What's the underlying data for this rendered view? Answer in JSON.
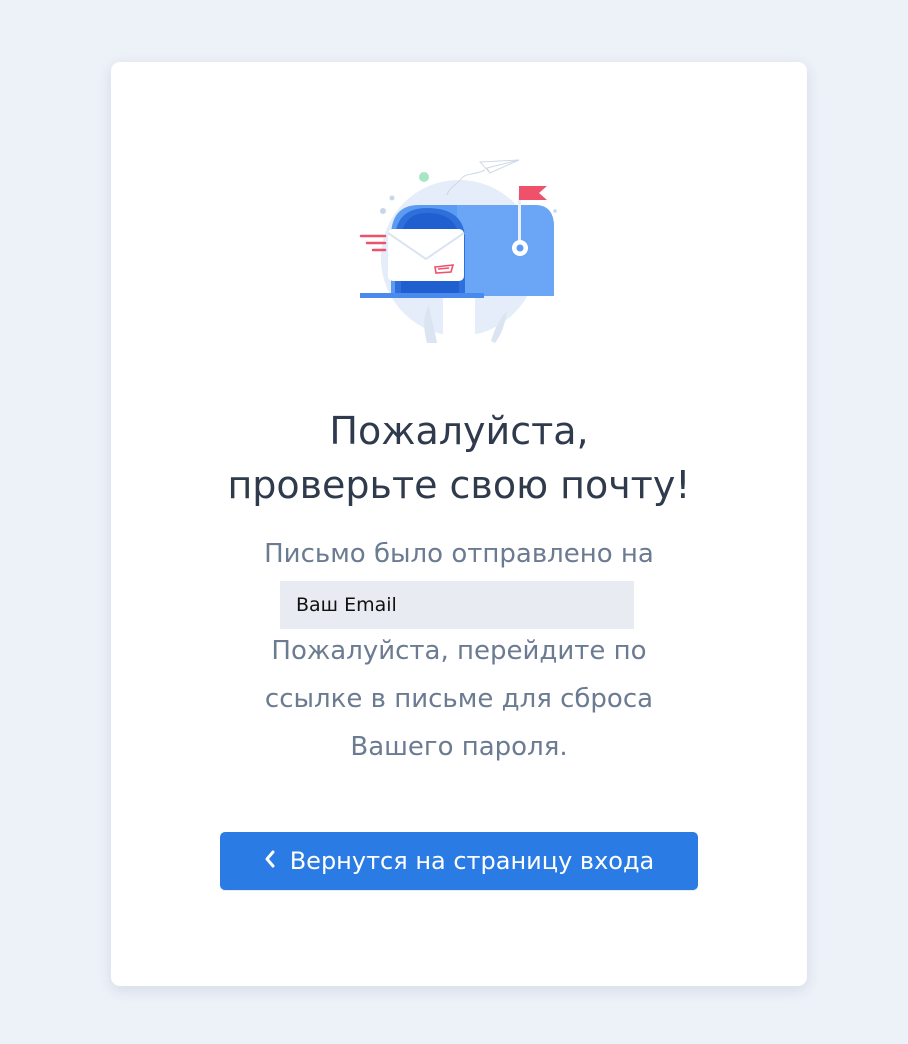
{
  "page": {
    "title_line1": "Пожалуйста,",
    "title_line2": "проверьте свою почту!",
    "sent_to_text": "Письмо было отправлено на",
    "email_value": "Ваш Email",
    "instruction_line1": "Пожалуйста, перейдите по",
    "instruction_line2": "ссылке в письме для сброса",
    "instruction_line3": "Вашего пароля.",
    "back_button_label": "Вернутся на страницу входа",
    "back_button_icon": "chevron-left-icon",
    "illustration": "mailbox-icon"
  },
  "colors": {
    "background": "#edf1f8",
    "card": "#ffffff",
    "title": "#2f3b4c",
    "body_text": "#6b7b91",
    "email_field": "#e8ecf2",
    "button": "#2a7be3",
    "flag": "#f0516a",
    "mailbox": "#4a90f0"
  }
}
